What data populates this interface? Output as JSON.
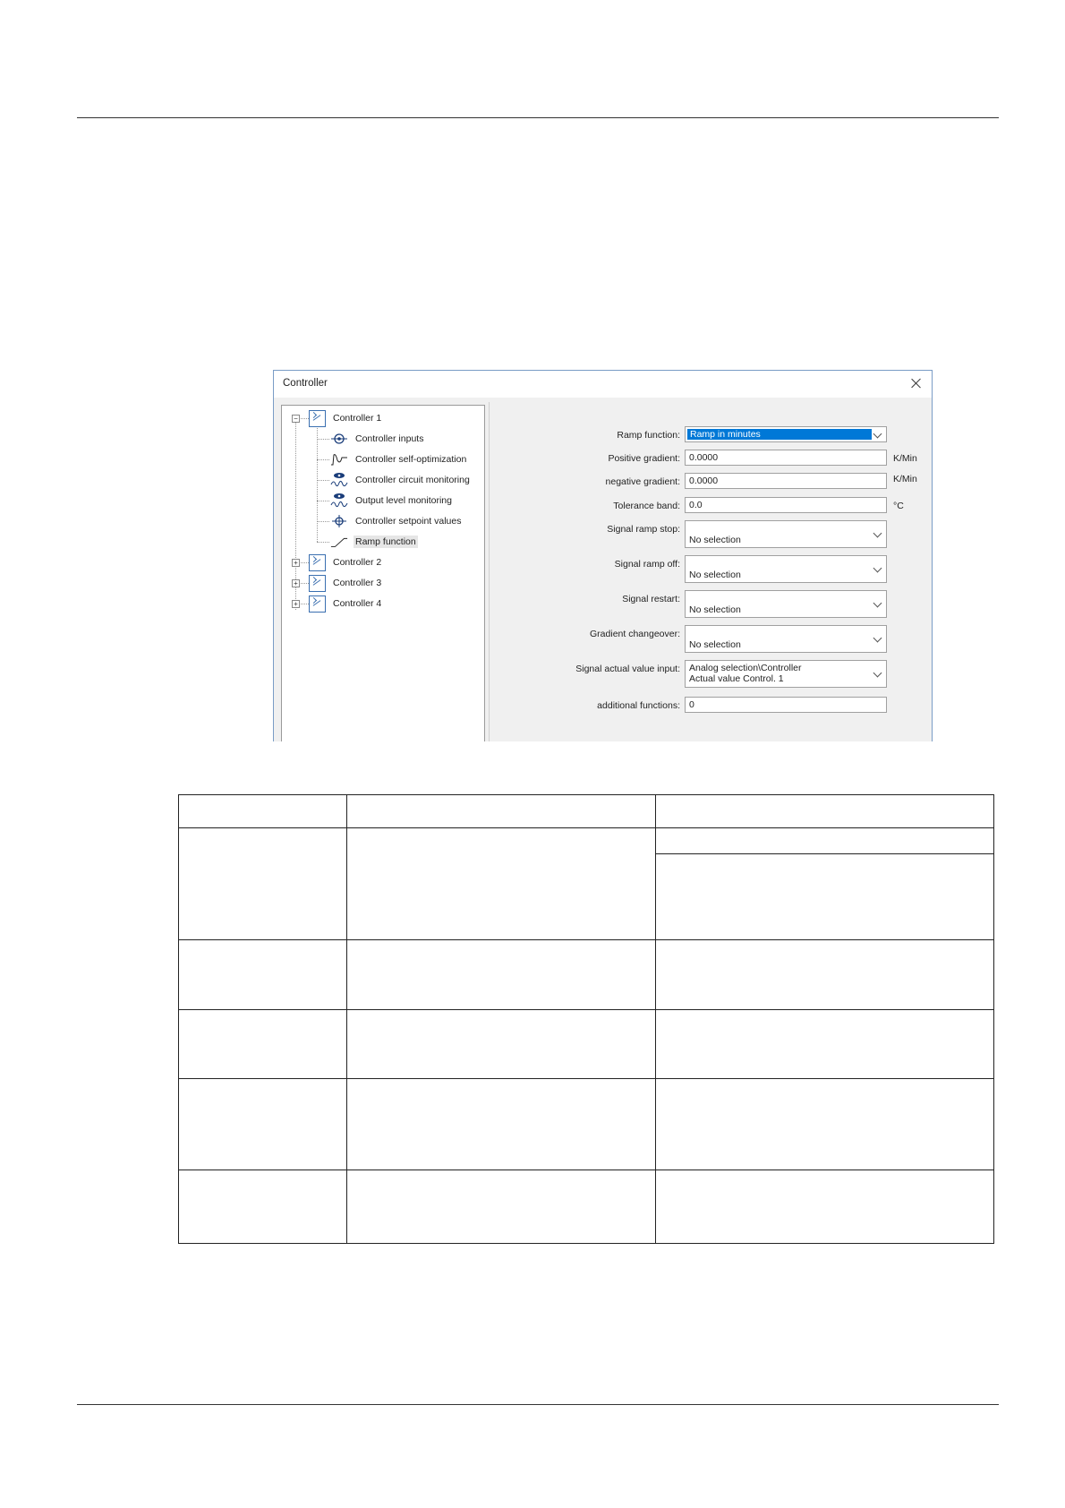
{
  "dialog": {
    "title": "Controller",
    "tree": {
      "controller1": "Controller 1",
      "children": [
        "Controller inputs",
        "Controller self-optimization",
        "Controller circuit monitoring",
        "Output level monitoring",
        "Controller setpoint values",
        "Ramp function"
      ],
      "controller2": "Controller 2",
      "controller3": "Controller 3",
      "controller4": "Controller 4",
      "selected": "Ramp function"
    },
    "form": {
      "ramp_function_label": "Ramp function:",
      "ramp_function_value": "Ramp in minutes",
      "positive_gradient_label": "Positive gradient:",
      "positive_gradient_value": "0.0000",
      "positive_gradient_unit": "K/Min",
      "negative_gradient_label": "negative gradient:",
      "negative_gradient_value": "0.0000",
      "negative_gradient_unit": "K/Min",
      "tolerance_band_label": "Tolerance band:",
      "tolerance_band_value": "0.0",
      "tolerance_band_unit": "°C",
      "signal_ramp_stop_label": "Signal ramp stop:",
      "signal_ramp_stop_value": "No selection",
      "signal_ramp_off_label": "Signal ramp off:",
      "signal_ramp_off_value": "No selection",
      "signal_restart_label": "Signal restart:",
      "signal_restart_value": "No selection",
      "gradient_changeover_label": "Gradient changeover:",
      "gradient_changeover_value": "No selection",
      "signal_actual_value_label": "Signal actual value input:",
      "signal_actual_value_line1": "Analog selection\\Controller",
      "signal_actual_value_line2": "Actual value Control. 1",
      "additional_functions_label": "additional functions:",
      "additional_functions_value": "0"
    }
  },
  "colors": {
    "selection": "#0078d7",
    "icon_blue": "#3a6fb0",
    "title_border": "#7a9cc6"
  }
}
